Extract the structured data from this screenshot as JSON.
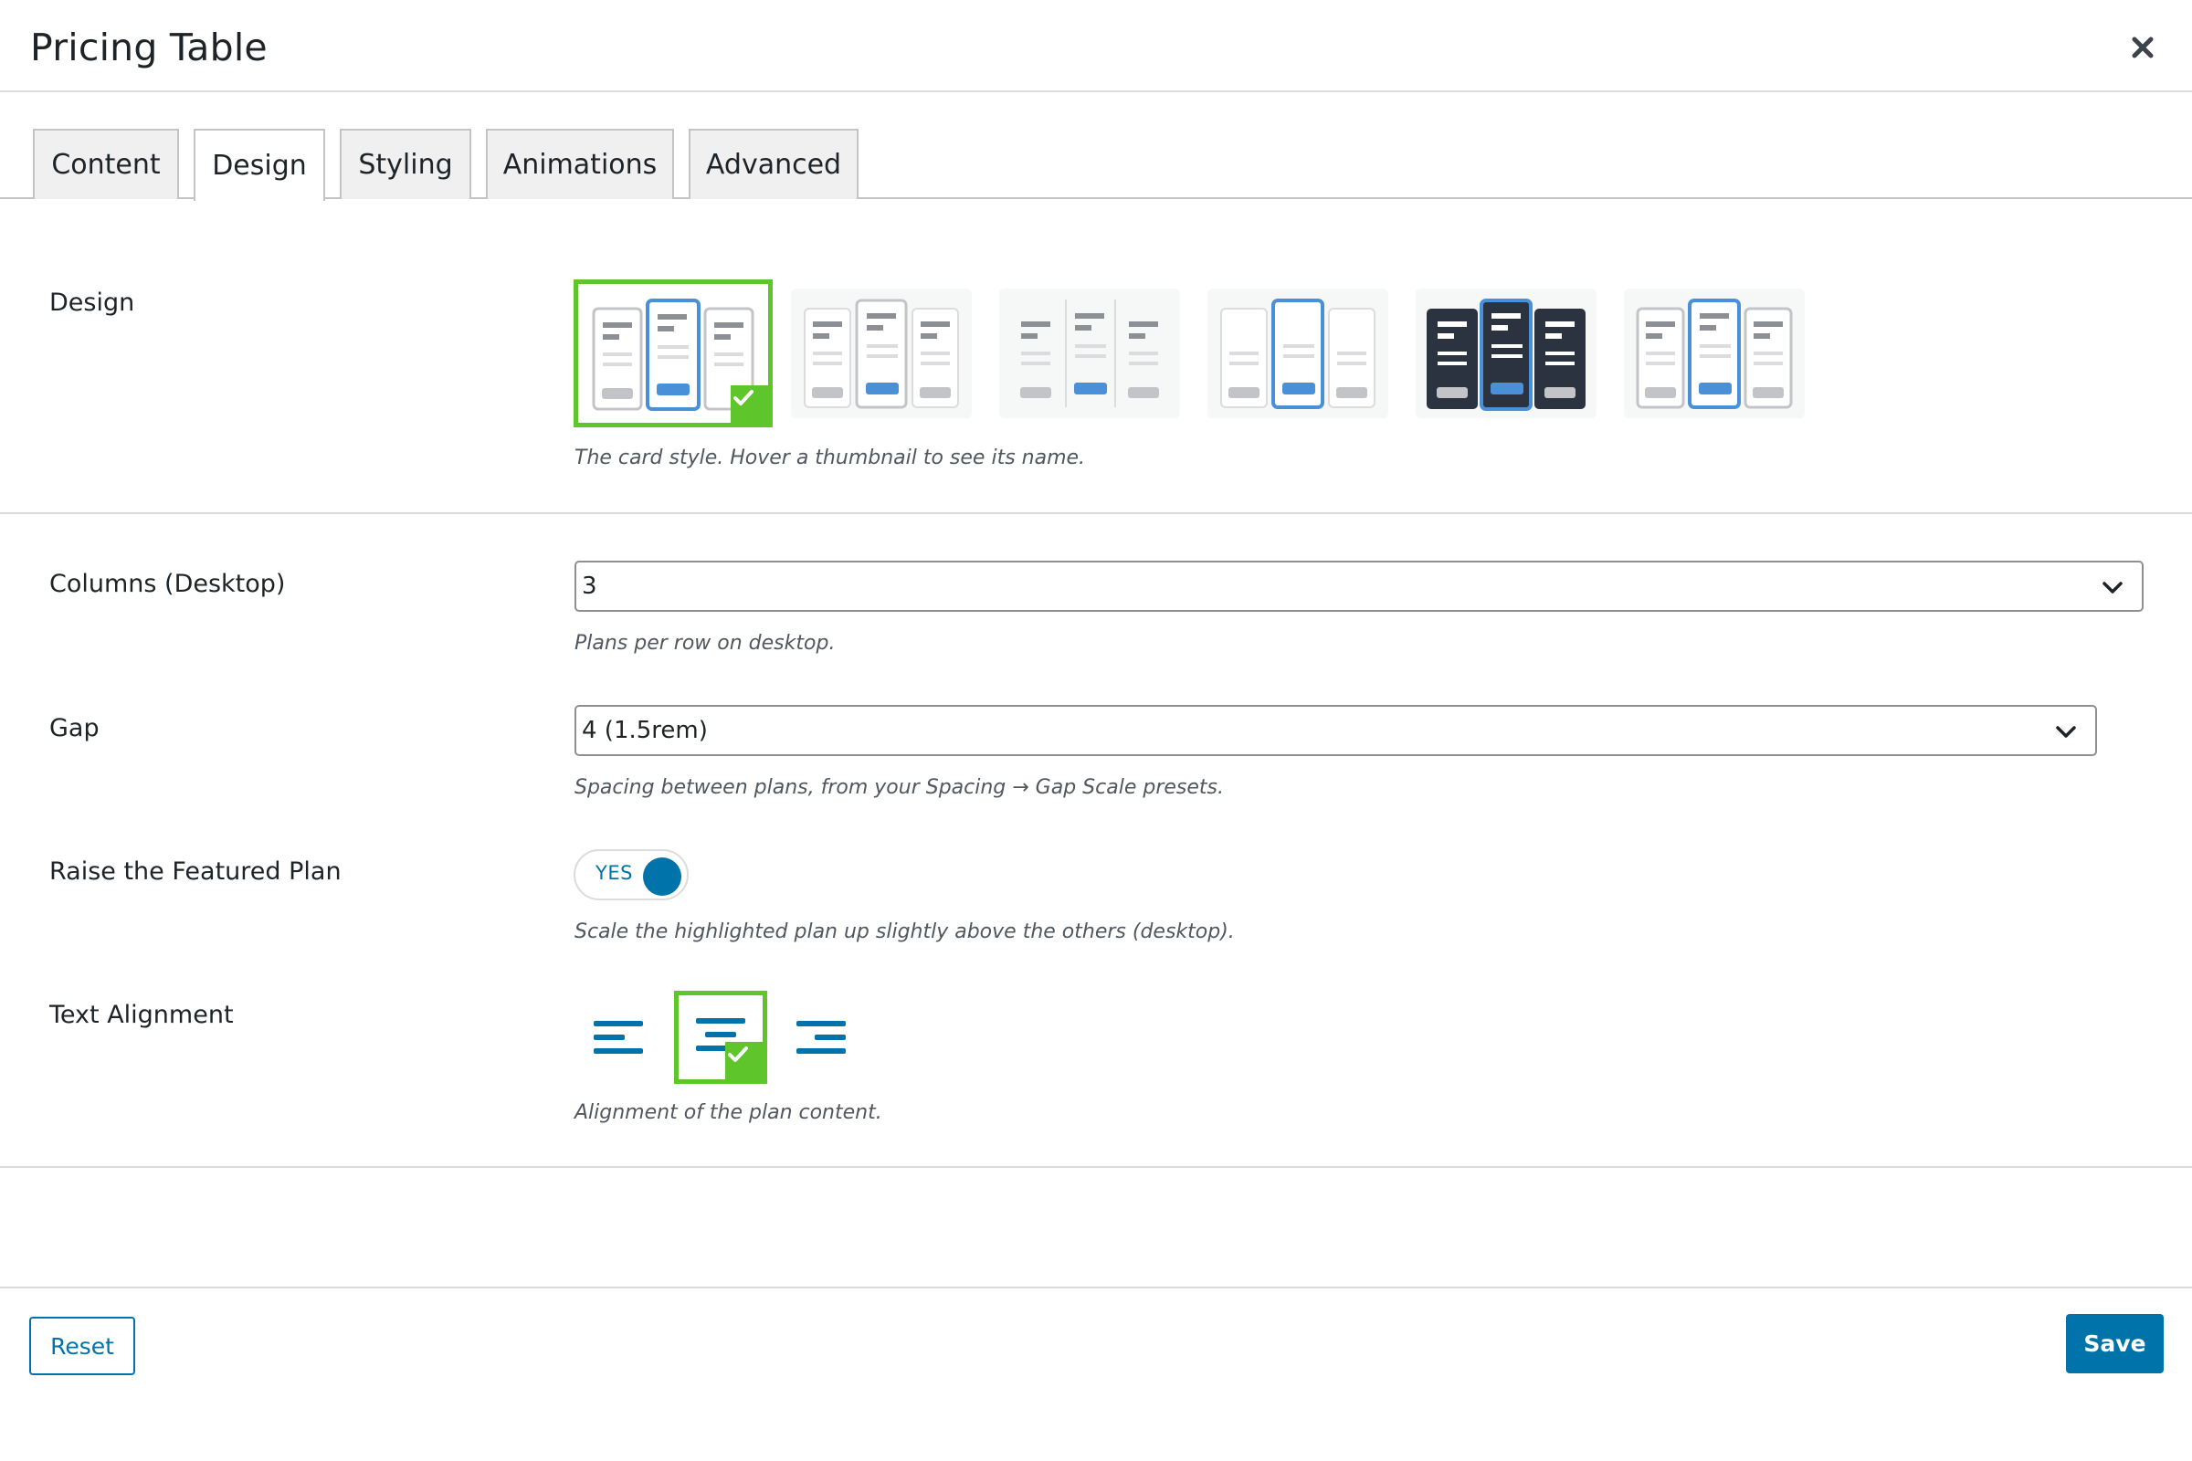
{
  "modal": {
    "title": "Pricing Table",
    "close_icon": "close-icon"
  },
  "tabs": [
    {
      "label": "Content",
      "active": false
    },
    {
      "label": "Design",
      "active": true
    },
    {
      "label": "Styling",
      "active": false
    },
    {
      "label": "Animations",
      "active": false
    },
    {
      "label": "Advanced",
      "active": false
    }
  ],
  "fields": {
    "design": {
      "label": "Design",
      "help": "The card style. Hover a thumbnail to see its name.",
      "options_count": 6,
      "selected_index": 0
    },
    "columns": {
      "label": "Columns (Desktop)",
      "value": "3",
      "help": "Plans per row on desktop."
    },
    "gap": {
      "label": "Gap",
      "value": "4 (1.5rem)",
      "help": "Spacing between plans, from your Spacing → Gap Scale presets."
    },
    "raise_featured": {
      "label": "Raise the Featured Plan",
      "toggle_text": "YES",
      "enabled": true,
      "help": "Scale the highlighted plan up slightly above the others (desktop)."
    },
    "text_alignment": {
      "label": "Text Alignment",
      "options": [
        "align-left-icon",
        "align-center-icon",
        "align-right-icon"
      ],
      "selected": "align-center-icon",
      "help": "Alignment of the plan content."
    }
  },
  "footer": {
    "reset_label": "Reset",
    "save_label": "Save"
  },
  "colors": {
    "accent": "#0073aa",
    "selected_border": "#5ec52b",
    "thumb_blue": "#4a90d9",
    "dark_card": "#2c3340"
  }
}
